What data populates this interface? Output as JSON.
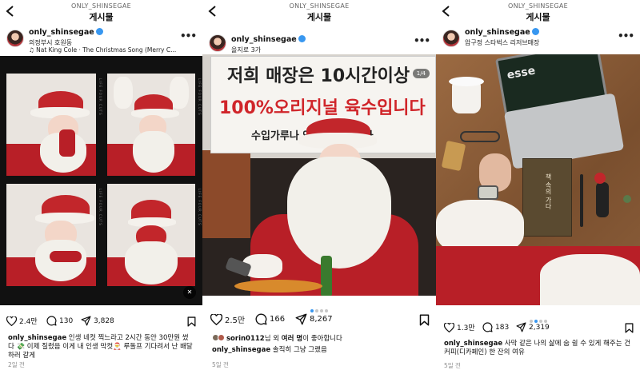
{
  "posts": [
    {
      "topbar": {
        "username": "ONLY_SHINSEGAE",
        "title": "게시물"
      },
      "header": {
        "username": "only_shinsegae",
        "location": "의정부시 호원동",
        "music": "Nat King Cole · The Christmas Song (Merry C..."
      },
      "actions": {
        "likes": "2.4만",
        "comments": "130",
        "shares": "3,828"
      },
      "caption": {
        "username": "only_shinsegae",
        "text": "인생 네컷 찍느라고 2시간 동안 30만원 썼다 💸 이제 질렸음 이게 내 인생 막컷🎅 루돌프 기다려서 난 배달하러 갈게"
      },
      "date": "2일 전",
      "media": {
        "label": "LIFE FOUR CUTS"
      }
    },
    {
      "topbar": {
        "username": "ONLY_SHINSEGAE",
        "title": "게시물"
      },
      "header": {
        "username": "only_shinsegae",
        "location": "을지로 3가"
      },
      "media": {
        "counter": "1/4",
        "banner_line1": "저희 매장은 10시간이상 ",
        "banner_line2": "100%오리지널 육수입니다",
        "banner_line3": "수입가루나 액상을   않습니다"
      },
      "actions": {
        "likes": "2.5만",
        "comments": "166",
        "shares": "8,267"
      },
      "liked_by": {
        "user": "sorin0112",
        "text1": "님 외 ",
        "bold": "여러 명",
        "text2": "이 좋아합니다"
      },
      "caption": {
        "username": "only_shinsegae",
        "text": "솔직히 그냥 그랬음"
      },
      "date": "5일 전"
    },
    {
      "topbar": {
        "username": "ONLY_SHINSEGAE",
        "title": "게시물"
      },
      "header": {
        "username": "only_shinsegae",
        "location": "압구정 스타벅스 리저브매장"
      },
      "media": {
        "screen_text": "esse",
        "book_title": "책 속의 가다"
      },
      "actions": {
        "likes": "1.3만",
        "comments": "183",
        "shares": "2,319"
      },
      "caption": {
        "username": "only_shinsegae",
        "text": "사막 같은 나의 삶에 숨 쉴 수 있게 해주는 건 커피(디카페인) 한 잔의 여유"
      },
      "date": "5일 전"
    }
  ],
  "colors": {
    "verified": "#3897f0",
    "accent_red": "#c2262b"
  }
}
